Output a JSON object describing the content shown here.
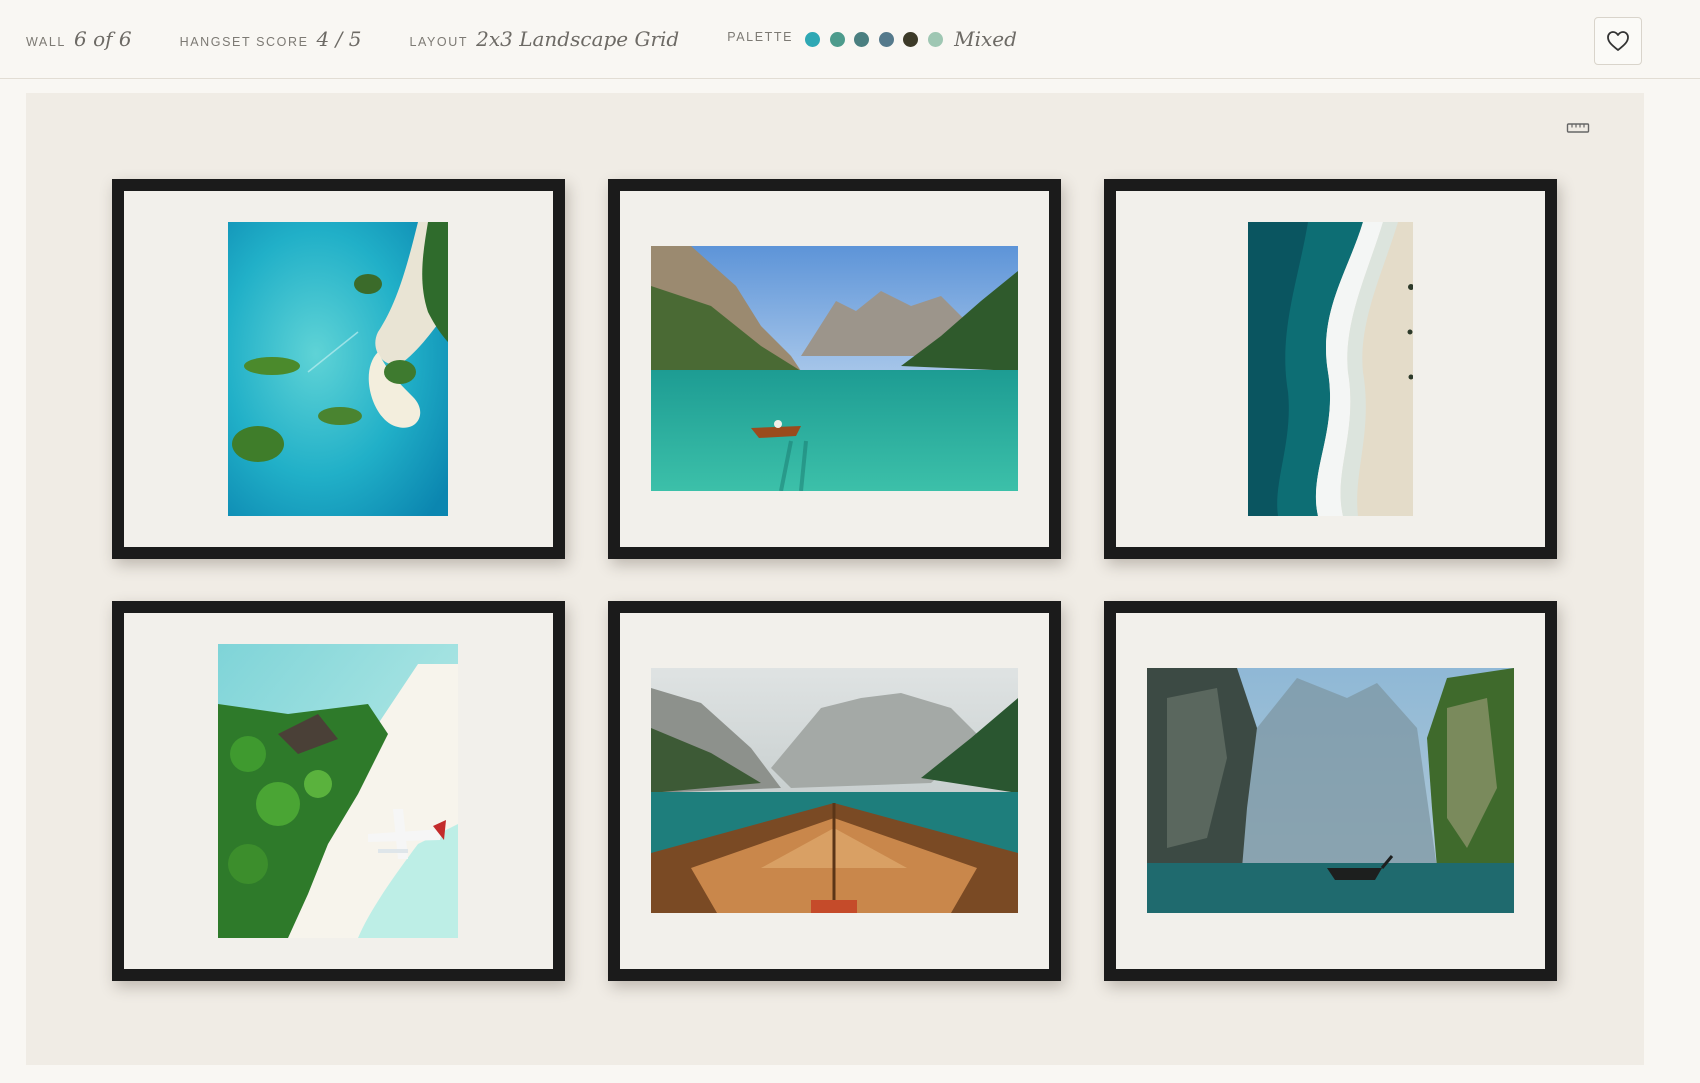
{
  "header": {
    "wall_label": "WALL",
    "wall_value": "6 of 6",
    "score_label": "HANGSET SCORE",
    "score_value": "4 / 5",
    "layout_label": "LAYOUT",
    "layout_value": "2x3 Landscape Grid",
    "palette_label": "PALETTE",
    "palette_name": "Mixed",
    "palette_colors": [
      "#2fa8b4",
      "#4d9b8c",
      "#4a7f80",
      "#557a8c",
      "#3d3a28",
      "#9fc7b3"
    ]
  },
  "colors": {
    "frame": "#1b1b1b",
    "mat": "#f2f0eb",
    "wall": "#f0ece5",
    "background": "#f9f7f3"
  },
  "icons": {
    "favorite": "heart-icon",
    "measure": "ruler-icon"
  }
}
